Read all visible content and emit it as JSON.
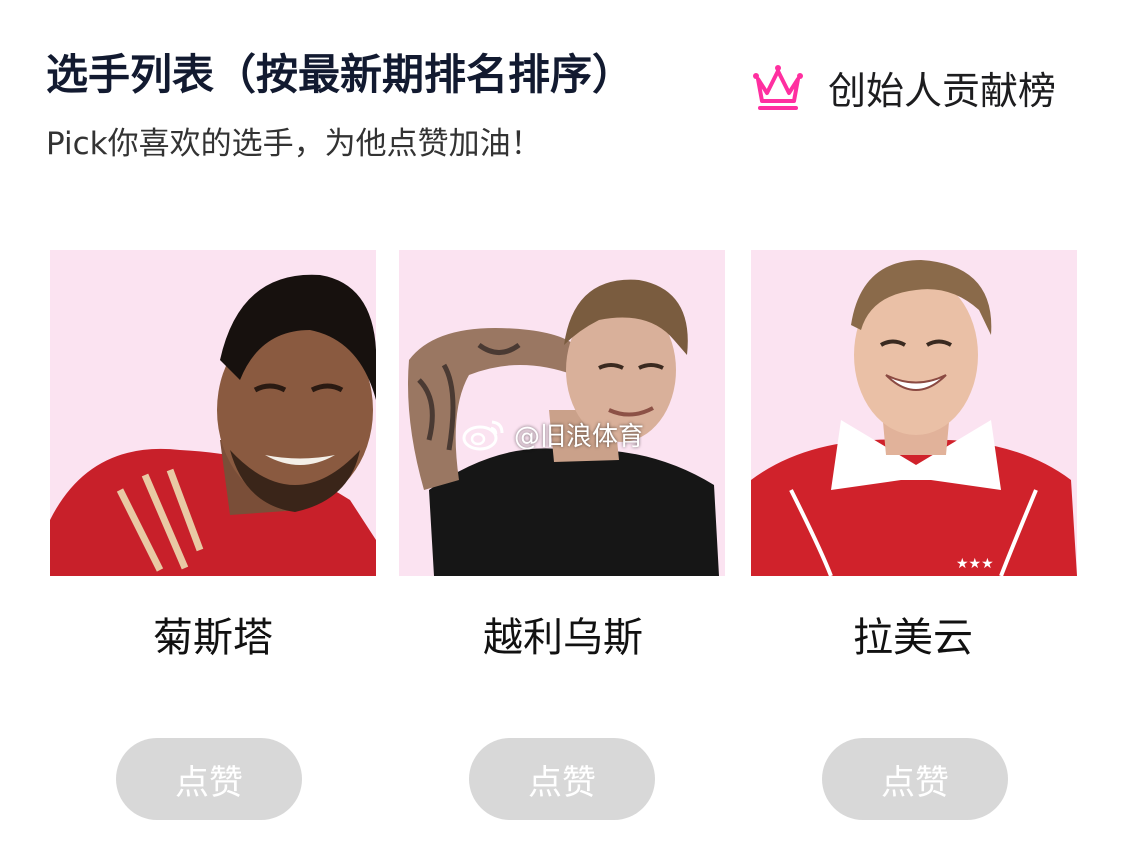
{
  "header": {
    "title": "选手列表（按最新期排名排序）",
    "subtitle": "Pick你喜欢的选手，为他点赞加油！",
    "board_label": "创始人贡献榜",
    "board_icon": "crown-icon"
  },
  "players": [
    {
      "name": "菊斯塔",
      "like_label": "点赞"
    },
    {
      "name": "越利乌斯",
      "like_label": "点赞"
    },
    {
      "name": "拉美云",
      "like_label": "点赞"
    }
  ],
  "watermark": {
    "icon": "weibo-icon",
    "text": "@旧浪体育"
  },
  "colors": {
    "crown": "#ff2fa0",
    "card_background": "#fbe3f1",
    "button_background": "#d8d8d8",
    "title": "#121a30"
  }
}
